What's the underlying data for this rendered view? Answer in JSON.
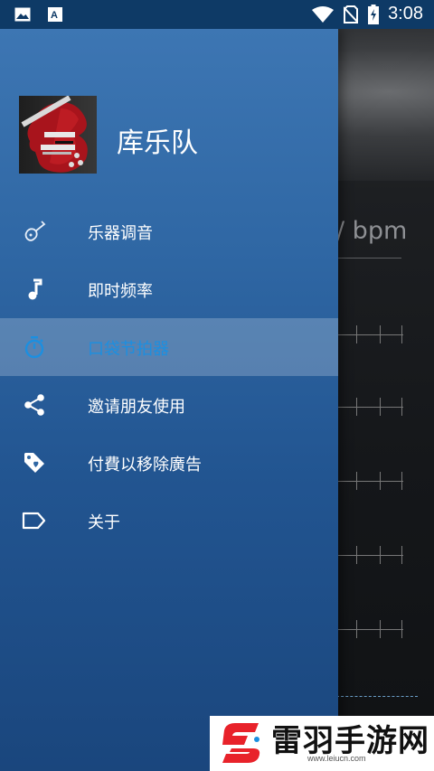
{
  "status_bar": {
    "time": "3:08",
    "left_icons": [
      "image-icon",
      "text-app-icon"
    ],
    "right_icons": [
      "wifi-icon",
      "no-sim-icon",
      "battery-charging-icon"
    ]
  },
  "drawer": {
    "app_name": "库乐队",
    "avatar_icon": "guitar-image",
    "items": [
      {
        "label": "乐器调音",
        "icon": "guitar-icon",
        "active": false
      },
      {
        "label": "即时频率",
        "icon": "music-note-icon",
        "active": false
      },
      {
        "label": "口袋节拍器",
        "icon": "stopwatch-icon",
        "active": true
      },
      {
        "label": "邀请朋友使用",
        "icon": "share-icon",
        "active": false
      },
      {
        "label": "付費以移除廣告",
        "icon": "tag-icon",
        "active": false
      },
      {
        "label": "关于",
        "icon": "label-icon",
        "active": false
      }
    ]
  },
  "background_app": {
    "bpm_text": "/ bpm"
  },
  "watermark": {
    "text": "雷羽手游网",
    "url": "www.leiucn.com"
  },
  "colors": {
    "accent": "#1c8fe0",
    "status_bar": "#0e3a66",
    "drawer_top": "#3d76b3",
    "drawer_bottom": "#1a467d"
  }
}
